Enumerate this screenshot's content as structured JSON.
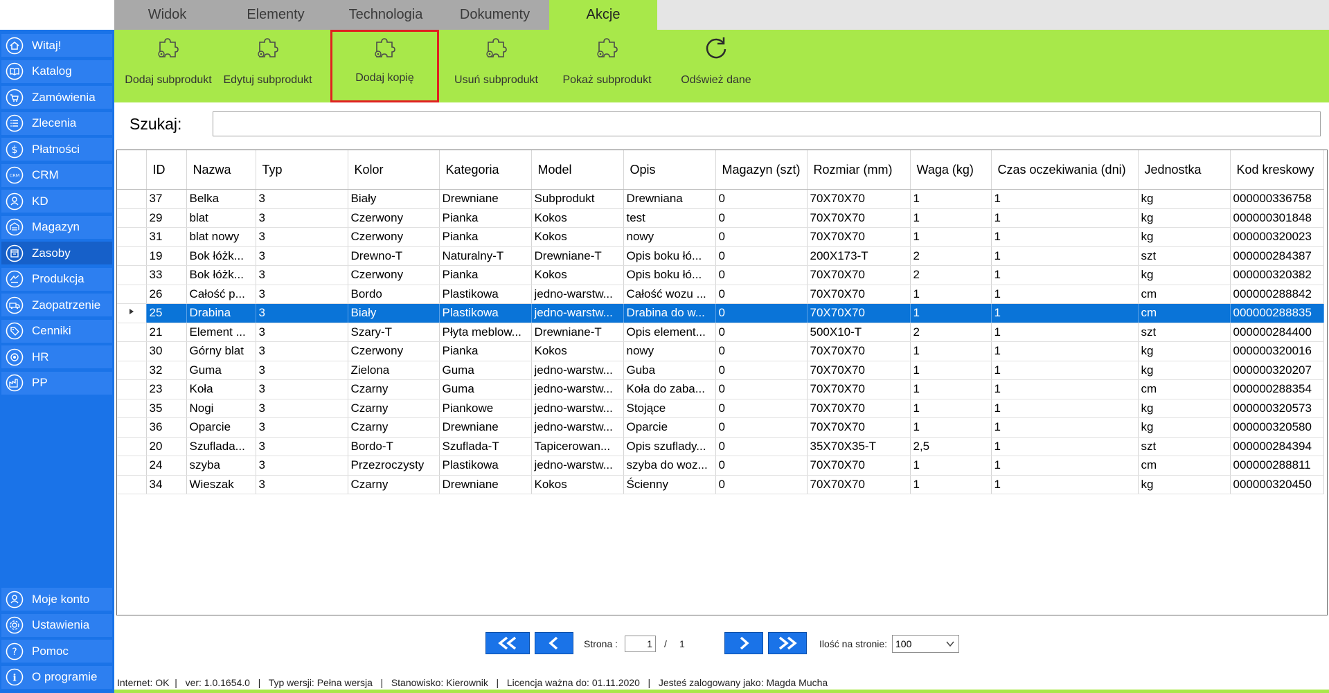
{
  "tabs": [
    {
      "label": "Widok"
    },
    {
      "label": "Elementy"
    },
    {
      "label": "Technologia"
    },
    {
      "label": "Dokumenty"
    },
    {
      "label": "Akcje",
      "active": true
    }
  ],
  "ribbon": [
    {
      "label": "Dodaj subprodukt",
      "icon": "puzzle-icon"
    },
    {
      "label": "Edytuj subprodukt",
      "icon": "puzzle-icon"
    },
    {
      "label": "Dodaj kopię",
      "icon": "puzzle-icon",
      "highlighted": true
    },
    {
      "label": "Usuń subprodukt",
      "icon": "puzzle-icon"
    },
    {
      "label": "Pokaż subprodukt",
      "icon": "puzzle-icon"
    },
    {
      "label": "Odśwież dane",
      "icon": "refresh-icon"
    }
  ],
  "sidebar": {
    "top_items": [
      {
        "label": "Witaj!",
        "icon": "home-icon"
      },
      {
        "label": "Katalog",
        "icon": "book-icon"
      },
      {
        "label": "Zamówienia",
        "icon": "cart-icon"
      },
      {
        "label": "Zlecenia",
        "icon": "list-icon"
      },
      {
        "label": "Płatności",
        "icon": "dollar-icon"
      },
      {
        "label": "CRM",
        "icon": "crm-icon"
      },
      {
        "label": "KD",
        "icon": "person-icon"
      },
      {
        "label": "Magazyn",
        "icon": "warehouse-icon"
      },
      {
        "label": "Zasoby",
        "icon": "box-icon",
        "active": true
      },
      {
        "label": "Produkcja",
        "icon": "production-icon"
      },
      {
        "label": "Zaopatrzenie",
        "icon": "truck-icon"
      },
      {
        "label": "Cenniki",
        "icon": "tag-icon"
      },
      {
        "label": "HR",
        "icon": "hr-icon"
      },
      {
        "label": "PP",
        "icon": "factory-icon"
      }
    ],
    "bottom_items": [
      {
        "label": "Moje konto",
        "icon": "user-icon"
      },
      {
        "label": "Ustawienia",
        "icon": "settings-icon"
      },
      {
        "label": "Pomoc",
        "icon": "help-icon"
      },
      {
        "label": "O programie",
        "icon": "info-icon"
      }
    ]
  },
  "search": {
    "label": "Szukaj:",
    "value": "",
    "placeholder": ""
  },
  "table": {
    "columns": [
      "ID",
      "Nazwa",
      "Typ",
      "Kolor",
      "Kategoria",
      "Model",
      "Opis",
      "Magazyn (szt)",
      "Rozmiar (mm)",
      "Waga (kg)",
      "Czas oczekiwania (dni)",
      "Jednostka",
      "Kod kreskowy"
    ],
    "selected_row": 6,
    "rows": [
      [
        "37",
        "Belka",
        "3",
        "Biały",
        "Drewniane",
        "Subprodukt",
        "Drewniana",
        "0",
        "70X70X70",
        "1",
        "1",
        "kg",
        "000000336758"
      ],
      [
        "29",
        "blat",
        "3",
        "Czerwony",
        "Pianka",
        "Kokos",
        "test",
        "0",
        "70X70X70",
        "1",
        "1",
        "kg",
        "000000301848"
      ],
      [
        "31",
        "blat nowy",
        "3",
        "Czerwony",
        "Pianka",
        "Kokos",
        "nowy",
        "0",
        "70X70X70",
        "1",
        "1",
        "kg",
        "000000320023"
      ],
      [
        "19",
        "Bok łóżk...",
        "3",
        "Drewno-T",
        "Naturalny-T",
        "Drewniane-T",
        "Opis boku łó...",
        "0",
        "200X173-T",
        "2",
        "1",
        "szt",
        "000000284387"
      ],
      [
        "33",
        "Bok łóżk...",
        "3",
        "Czerwony",
        "Pianka",
        "Kokos",
        "Opis boku łó...",
        "0",
        "70X70X70",
        "2",
        "1",
        "kg",
        "000000320382"
      ],
      [
        "26",
        "Całość p...",
        "3",
        "Bordo",
        "Plastikowa",
        "jedno-warstw...",
        "Całość wozu ...",
        "0",
        "70X70X70",
        "1",
        "1",
        "cm",
        "000000288842"
      ],
      [
        "25",
        "Drabina",
        "3",
        "Biały",
        "Plastikowa",
        "jedno-warstw...",
        "Drabina do w...",
        "0",
        "70X70X70",
        "1",
        "1",
        "cm",
        "000000288835"
      ],
      [
        "21",
        "Element ...",
        "3",
        "Szary-T",
        "Płyta meblow...",
        "Drewniane-T",
        "Opis element...",
        "0",
        "500X10-T",
        "2",
        "1",
        "szt",
        "000000284400"
      ],
      [
        "30",
        "Górny blat",
        "3",
        "Czerwony",
        "Pianka",
        "Kokos",
        "nowy",
        "0",
        "70X70X70",
        "1",
        "1",
        "kg",
        "000000320016"
      ],
      [
        "32",
        "Guma",
        "3",
        "Zielona",
        "Guma",
        "jedno-warstw...",
        "Guba",
        "0",
        "70X70X70",
        "1",
        "1",
        "kg",
        "000000320207"
      ],
      [
        "23",
        "Koła",
        "3",
        "Czarny",
        "Guma",
        "jedno-warstw...",
        "Koła do zaba...",
        "0",
        "70X70X70",
        "1",
        "1",
        "cm",
        "000000288354"
      ],
      [
        "35",
        "Nogi",
        "3",
        "Czarny",
        "Piankowe",
        "jedno-warstw...",
        "Stojące",
        "0",
        "70X70X70",
        "1",
        "1",
        "kg",
        "000000320573"
      ],
      [
        "36",
        "Oparcie",
        "3",
        "Czarny",
        "Drewniane",
        "jedno-warstw...",
        "Oparcie",
        "0",
        "70X70X70",
        "1",
        "1",
        "kg",
        "000000320580"
      ],
      [
        "20",
        "Szuflada...",
        "3",
        "Bordo-T",
        "Szuflada-T",
        "Tapicerowan...",
        "Opis szuflady...",
        "0",
        "35X70X35-T",
        "2,5",
        "1",
        "szt",
        "000000284394"
      ],
      [
        "24",
        "szyba",
        "3",
        "Przezroczysty",
        "Plastikowa",
        "jedno-warstw...",
        "szyba do woz...",
        "0",
        "70X70X70",
        "1",
        "1",
        "cm",
        "000000288811"
      ],
      [
        "34",
        "Wieszak",
        "3",
        "Czarny",
        "Drewniane",
        "Kokos",
        "Ścienny",
        "0",
        "70X70X70",
        "1",
        "1",
        "kg",
        "000000320450"
      ]
    ]
  },
  "pager": {
    "page_label": "Strona :",
    "current_page": "1",
    "separator": "/",
    "total_pages": "1",
    "per_page_label": "Ilość na stronie:",
    "per_page_value": "100"
  },
  "status": {
    "text": "Internet: OK  |   ver: 1.0.1654.0   |   Typ wersji: Pełna wersja   |   Stanowisko: Kierownik   |   Licencja ważna do: 01.11.2020   |   Jesteś zalogowany jako: Magda Mucha"
  },
  "colors": {
    "sidebar": "#1a73e8",
    "ribbon": "#a8e84a",
    "selection": "#0a74d8",
    "highlight_border": "#e02020"
  }
}
